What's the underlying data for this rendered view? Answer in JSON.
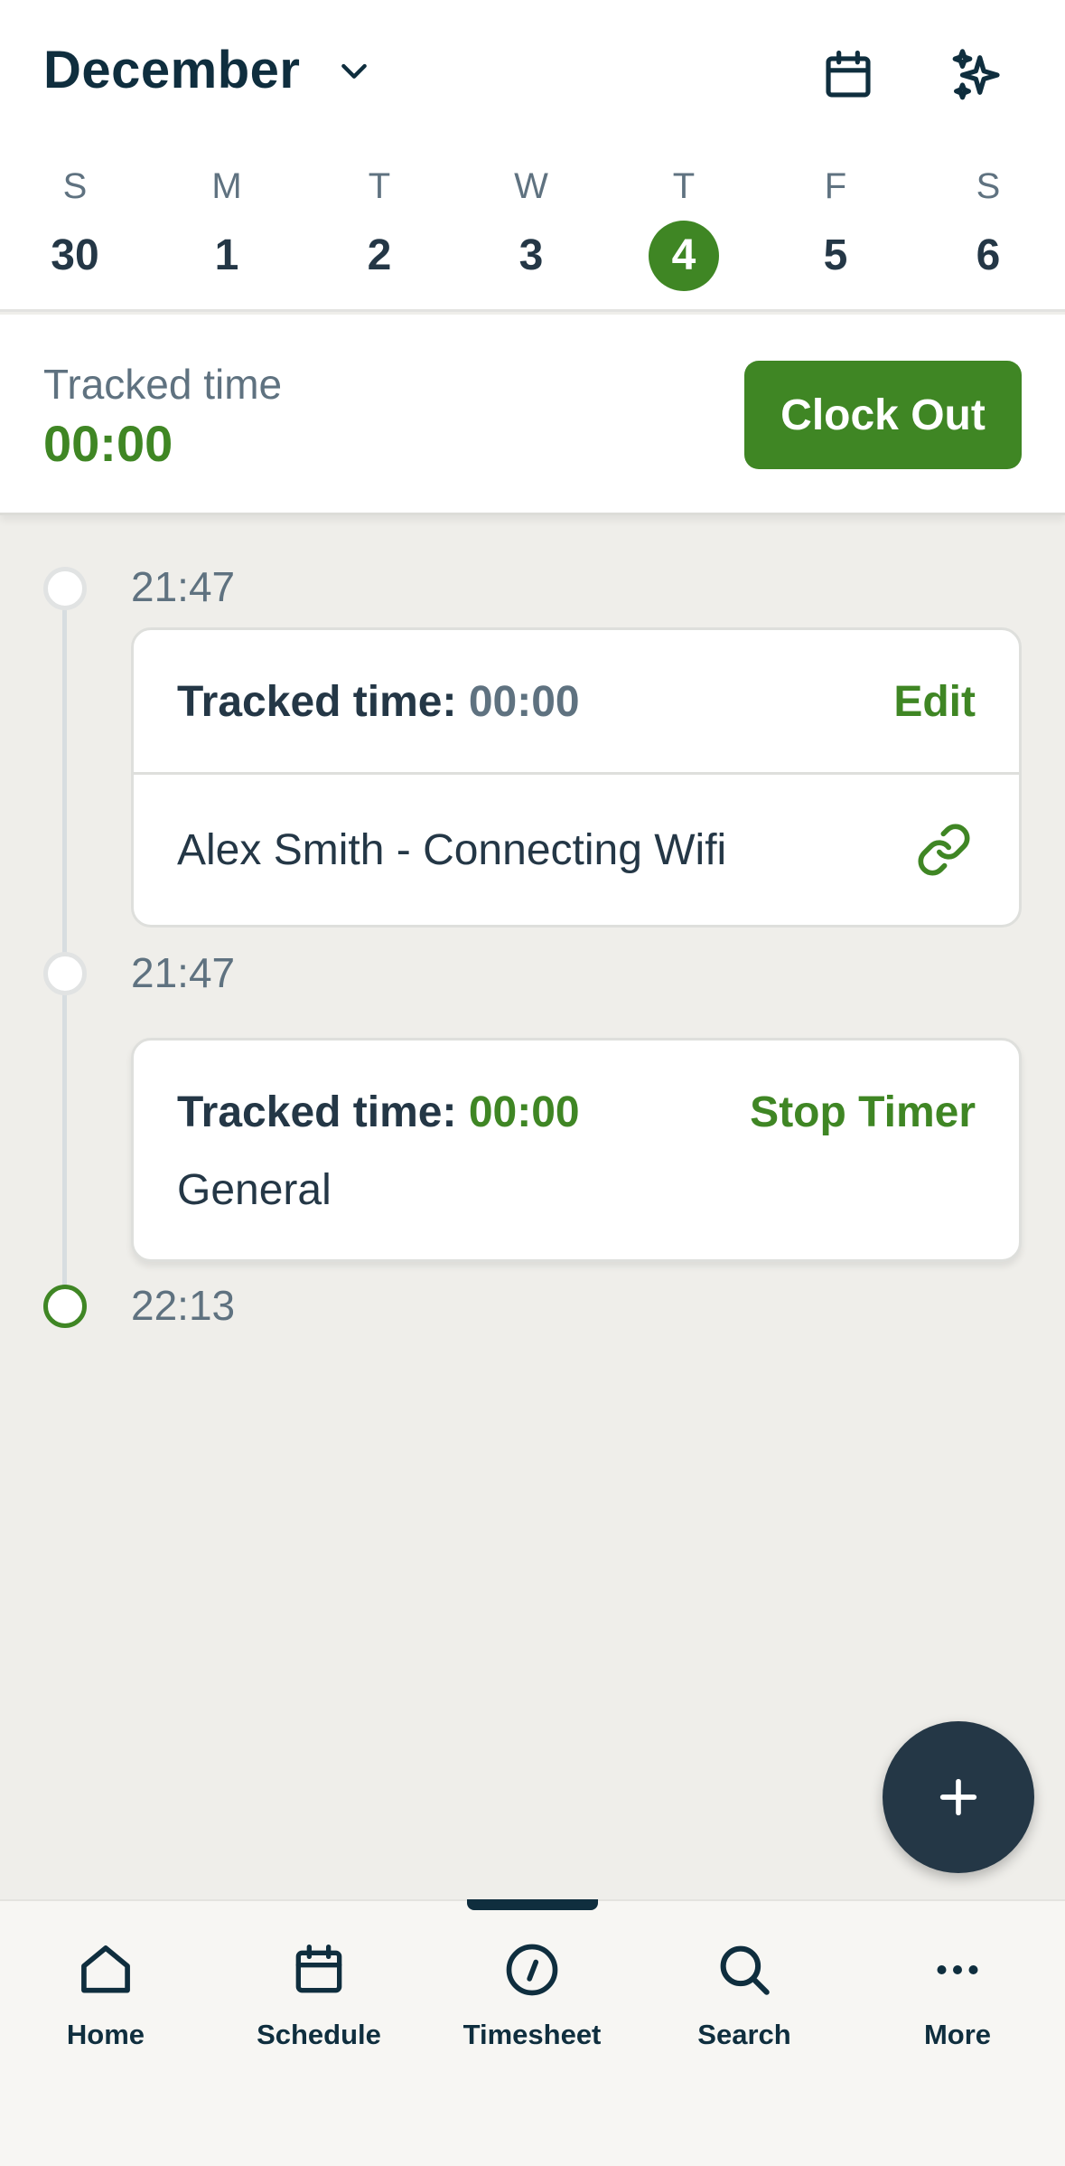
{
  "header": {
    "month": "December",
    "week": [
      {
        "dow": "S",
        "num": "30",
        "selected": false
      },
      {
        "dow": "M",
        "num": "1",
        "selected": false
      },
      {
        "dow": "T",
        "num": "2",
        "selected": false
      },
      {
        "dow": "W",
        "num": "3",
        "selected": false
      },
      {
        "dow": "T",
        "num": "4",
        "selected": true
      },
      {
        "dow": "F",
        "num": "5",
        "selected": false
      },
      {
        "dow": "S",
        "num": "6",
        "selected": false
      }
    ],
    "icons": [
      "calendar-icon",
      "sparkles-icon"
    ]
  },
  "tracked": {
    "label": "Tracked time",
    "value": "00:00",
    "clock_out_label": "Clock Out"
  },
  "timeline": {
    "entries": [
      {
        "time": "21:47",
        "tracked_label": "Tracked time:",
        "tracked_value": "00:00",
        "action": "Edit",
        "job": "Alex Smith - Connecting Wifi"
      },
      {
        "time": "21:47",
        "tracked_label": "Tracked time:",
        "tracked_value": "00:00",
        "action": "Stop Timer",
        "job": "General"
      }
    ],
    "end_time": "22:13"
  },
  "nav": {
    "items": [
      {
        "label": "Home",
        "icon": "home-icon"
      },
      {
        "label": "Schedule",
        "icon": "calendar-icon"
      },
      {
        "label": "Timesheet",
        "icon": "timesheet-icon",
        "active": true
      },
      {
        "label": "Search",
        "icon": "search-icon"
      },
      {
        "label": "More",
        "icon": "more-icon"
      }
    ]
  },
  "colors": {
    "accent": "#3f8624",
    "navy": "#243746",
    "background": "#efeeea"
  }
}
